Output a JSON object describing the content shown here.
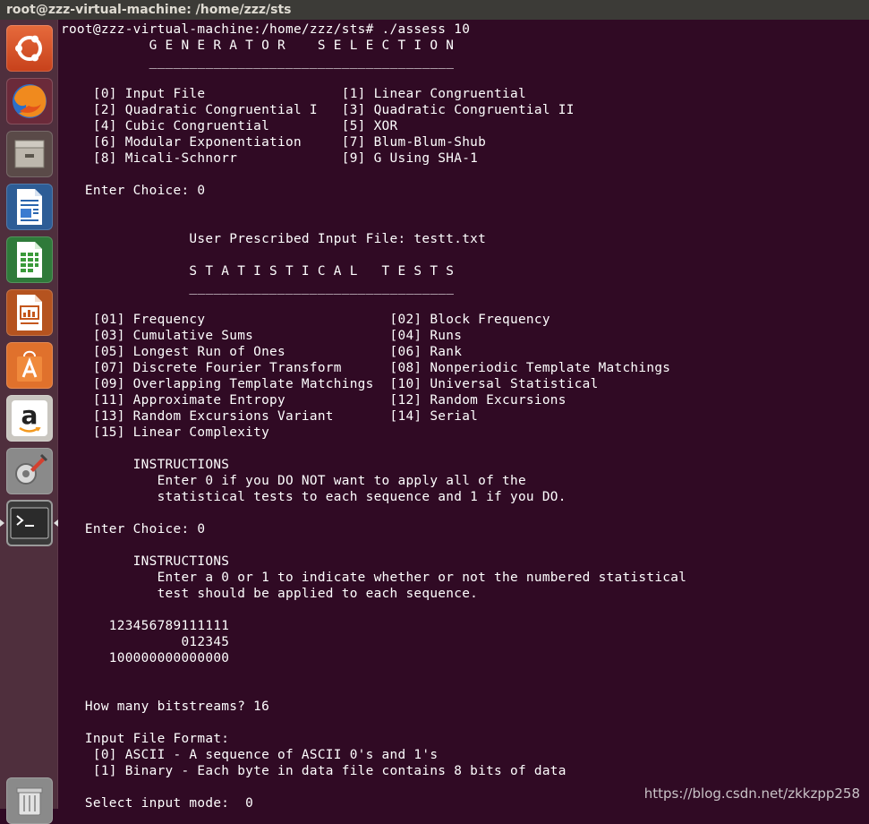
{
  "window": {
    "title": "root@zzz-virtual-machine: /home/zzz/sts"
  },
  "launcher": {
    "items": [
      {
        "name": "ubuntu-dash-icon"
      },
      {
        "name": "firefox-icon"
      },
      {
        "name": "files-icon"
      },
      {
        "name": "libreoffice-writer-icon"
      },
      {
        "name": "libreoffice-calc-icon"
      },
      {
        "name": "libreoffice-impress-icon"
      },
      {
        "name": "software-center-icon"
      },
      {
        "name": "amazon-icon"
      },
      {
        "name": "system-settings-icon"
      },
      {
        "name": "terminal-icon"
      },
      {
        "name": "trash-icon"
      }
    ],
    "amazon_letter": "a"
  },
  "terminal": {
    "lines": [
      "root@zzz-virtual-machine:/home/zzz/sts# ./assess 10",
      "           G E N E R A T O R    S E L E C T I O N",
      "           ______________________________________",
      "",
      "    [0] Input File                 [1] Linear Congruential",
      "    [2] Quadratic Congruential I   [3] Quadratic Congruential II",
      "    [4] Cubic Congruential         [5] XOR",
      "    [6] Modular Exponentiation     [7] Blum-Blum-Shub",
      "    [8] Micali-Schnorr             [9] G Using SHA-1",
      "",
      "   Enter Choice: 0",
      "",
      "",
      "                User Prescribed Input File: testt.txt",
      "",
      "                S T A T I S T I C A L   T E S T S",
      "                _________________________________",
      "",
      "    [01] Frequency                       [02] Block Frequency",
      "    [03] Cumulative Sums                 [04] Runs",
      "    [05] Longest Run of Ones             [06] Rank",
      "    [07] Discrete Fourier Transform      [08] Nonperiodic Template Matchings",
      "    [09] Overlapping Template Matchings  [10] Universal Statistical",
      "    [11] Approximate Entropy             [12] Random Excursions",
      "    [13] Random Excursions Variant       [14] Serial",
      "    [15] Linear Complexity",
      "",
      "         INSTRUCTIONS",
      "            Enter 0 if you DO NOT want to apply all of the",
      "            statistical tests to each sequence and 1 if you DO.",
      "",
      "   Enter Choice: 0",
      "",
      "         INSTRUCTIONS",
      "            Enter a 0 or 1 to indicate whether or not the numbered statistical",
      "            test should be applied to each sequence.",
      "",
      "      123456789111111",
      "               012345",
      "      100000000000000",
      "",
      "",
      "   How many bitstreams? 16",
      "",
      "   Input File Format:",
      "    [0] ASCII - A sequence of ASCII 0's and 1's",
      "    [1] Binary - Each byte in data file contains 8 bits of data",
      "",
      "   Select input mode:  0"
    ]
  },
  "watermark": "https://blog.csdn.net/zkkzpp258",
  "colors": {
    "terminal_bg": "#300a24",
    "launcher_bg": "#4f2f3d",
    "titlebar_bg": "#3c3b37",
    "text": "#ffffff"
  }
}
